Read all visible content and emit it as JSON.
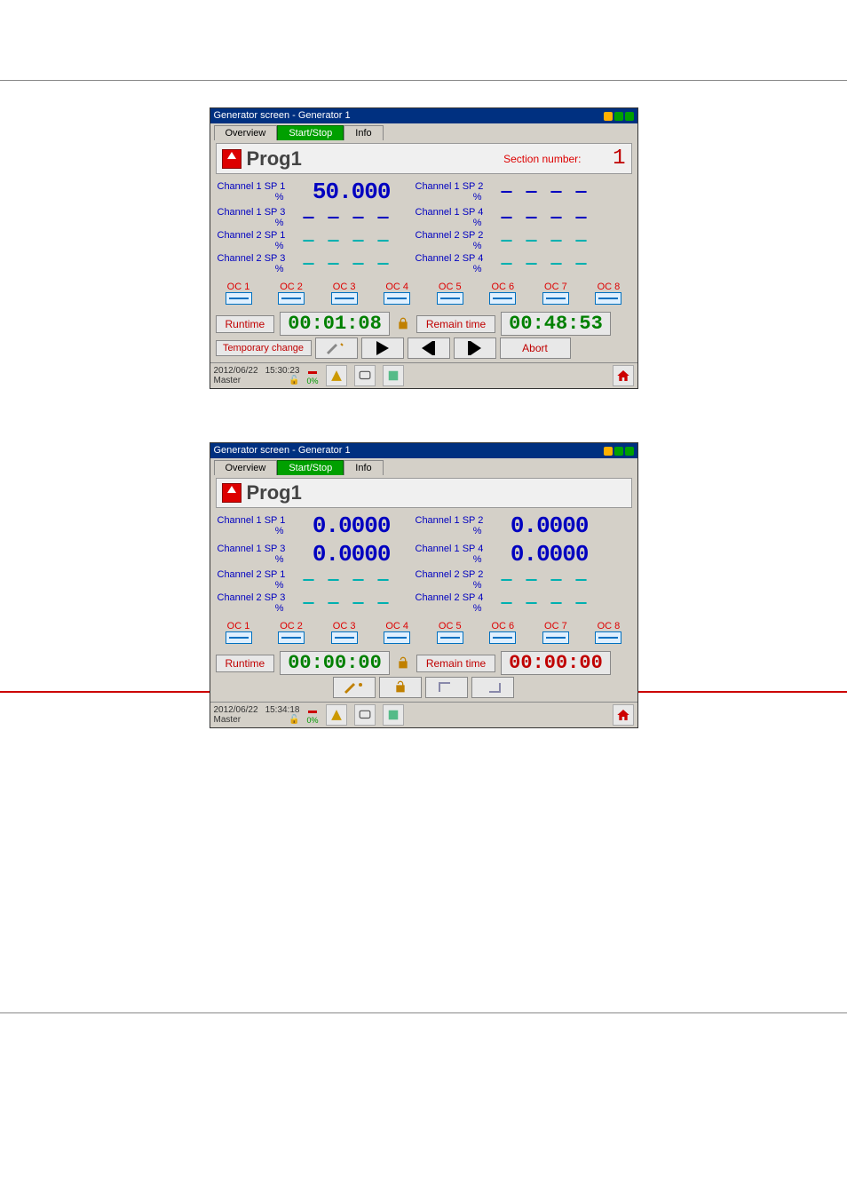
{
  "screens": [
    {
      "title": "Generator screen - Generator 1",
      "tabs": {
        "overview": "Overview",
        "start_stop": "Start/Stop",
        "info": "Info",
        "active": "start_stop"
      },
      "prog_name": "Prog1",
      "section_label": "Section number:",
      "section_number": "1",
      "show_section": true,
      "channels": [
        {
          "l": "Channel 1 SP 1",
          "lu": "%",
          "lv": "50.000",
          "lvcls": "",
          "r": "Channel 1 SP 2",
          "ru": "%",
          "rv": "— — — —",
          "rvcls": "blank"
        },
        {
          "l": "Channel 1 SP 3",
          "lu": "%",
          "lv": "— — — —",
          "lvcls": "blank",
          "r": "Channel 1 SP 4",
          "ru": "%",
          "rv": "— — — —",
          "rvcls": "blank"
        },
        {
          "l": "Channel 2 SP 1",
          "lu": "%",
          "lv": "— — — —",
          "lvcls": "blank cyan",
          "r": "Channel 2 SP 2",
          "ru": "%",
          "rv": "— — — —",
          "rvcls": "blank cyan"
        },
        {
          "l": "Channel 2 SP 3",
          "lu": "%",
          "lv": "— — — —",
          "lvcls": "blank cyan",
          "r": "Channel 2 SP 4",
          "ru": "%",
          "rv": "— — — —",
          "rvcls": "blank cyan"
        }
      ],
      "oc": [
        "OC 1",
        "OC 2",
        "OC 3",
        "OC 4",
        "OC 5",
        "OC 6",
        "OC 7",
        "OC 8"
      ],
      "runtime": {
        "label": "Runtime",
        "value": "00:01:08",
        "color": "green",
        "lock": "closed"
      },
      "remain": {
        "label": "Remain time",
        "value": "00:48:53",
        "color": "green"
      },
      "controls": {
        "tc_label": "Temporary change",
        "abort": "Abort",
        "play": true,
        "abort_enabled": true
      },
      "status": {
        "date": "2012/06/22",
        "time": "15:30:23",
        "user": "Master",
        "percent": "0%"
      },
      "red_arrow": false
    },
    {
      "title": "Generator screen - Generator 1",
      "tabs": {
        "overview": "Overview",
        "start_stop": "Start/Stop",
        "info": "Info",
        "active": "start_stop"
      },
      "prog_name": "Prog1",
      "section_label": "",
      "section_number": "",
      "show_section": false,
      "channels": [
        {
          "l": "Channel 1 SP 1",
          "lu": "%",
          "lv": "0.0000",
          "lvcls": "",
          "r": "Channel 1 SP 2",
          "ru": "%",
          "rv": "0.0000",
          "rvcls": ""
        },
        {
          "l": "Channel 1 SP 3",
          "lu": "%",
          "lv": "0.0000",
          "lvcls": "",
          "r": "Channel 1 SP 4",
          "ru": "%",
          "rv": "0.0000",
          "rvcls": ""
        },
        {
          "l": "Channel 2 SP 1",
          "lu": "%",
          "lv": "— — — —",
          "lvcls": "blank cyan",
          "r": "Channel 2 SP 2",
          "ru": "%",
          "rv": "— — — —",
          "rvcls": "blank cyan"
        },
        {
          "l": "Channel 2 SP 3",
          "lu": "%",
          "lv": "— — — —",
          "lvcls": "blank cyan",
          "r": "Channel 2 SP 4",
          "ru": "%",
          "rv": "— — — —",
          "rvcls": "blank cyan"
        }
      ],
      "oc": [
        "OC 1",
        "OC 2",
        "OC 3",
        "OC 4",
        "OC 5",
        "OC 6",
        "OC 7",
        "OC 8"
      ],
      "runtime": {
        "label": "Runtime",
        "value": "00:00:00",
        "color": "green",
        "lock": "open"
      },
      "remain": {
        "label": "Remain time",
        "value": "00:00:00",
        "color": "red"
      },
      "controls": {
        "tc_label": "",
        "abort": "",
        "play": false,
        "abort_enabled": false
      },
      "status": {
        "date": "2012/06/22",
        "time": "15:34:18",
        "user": "Master",
        "percent": "0%"
      },
      "red_arrow": true
    }
  ]
}
